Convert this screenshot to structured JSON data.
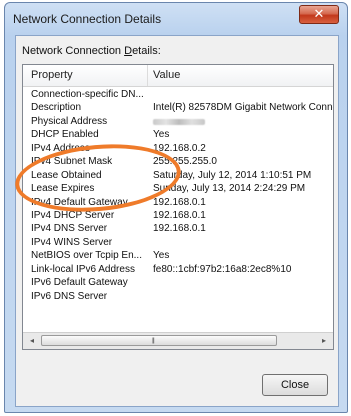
{
  "window": {
    "title": "Network Connection Details",
    "close_glyph": "✕"
  },
  "group_label": {
    "pre": "Network Connection ",
    "underlined": "D",
    "post": "etails:"
  },
  "columns": [
    "Property",
    "Value"
  ],
  "rows": [
    {
      "property": "Connection-specific DN...",
      "value": ""
    },
    {
      "property": "Description",
      "value": "Intel(R) 82578DM Gigabit Network Conne"
    },
    {
      "property": "Physical Address",
      "value": ""
    },
    {
      "property": "DHCP Enabled",
      "value": "Yes"
    },
    {
      "property": "IPv4 Address",
      "value": "192.168.0.2"
    },
    {
      "property": "IPv4 Subnet Mask",
      "value": "255.255.255.0"
    },
    {
      "property": "Lease Obtained",
      "value": "Saturday, July 12, 2014 1:10:51 PM"
    },
    {
      "property": "Lease Expires",
      "value": "Sunday, July 13, 2014 2:24:29 PM"
    },
    {
      "property": "IPv4 Default Gateway",
      "value": "192.168.0.1"
    },
    {
      "property": "IPv4 DHCP Server",
      "value": "192.168.0.1"
    },
    {
      "property": "IPv4 DNS Server",
      "value": "192.168.0.1"
    },
    {
      "property": "IPv4 WINS Server",
      "value": ""
    },
    {
      "property": "NetBIOS over Tcpip En...",
      "value": "Yes"
    },
    {
      "property": "Link-local IPv6 Address",
      "value": "fe80::1cbf:97b2:16a8:2ec8%10"
    },
    {
      "property": "IPv6 Default Gateway",
      "value": ""
    },
    {
      "property": "IPv6 DNS Server",
      "value": ""
    }
  ],
  "scrollbar": {
    "left_arrow": "◂",
    "right_arrow": "▸",
    "grip": "|||"
  },
  "close_button_label": "Close",
  "colors": {
    "highlight": "#ef7b2a",
    "title_close": "#c2381b"
  }
}
